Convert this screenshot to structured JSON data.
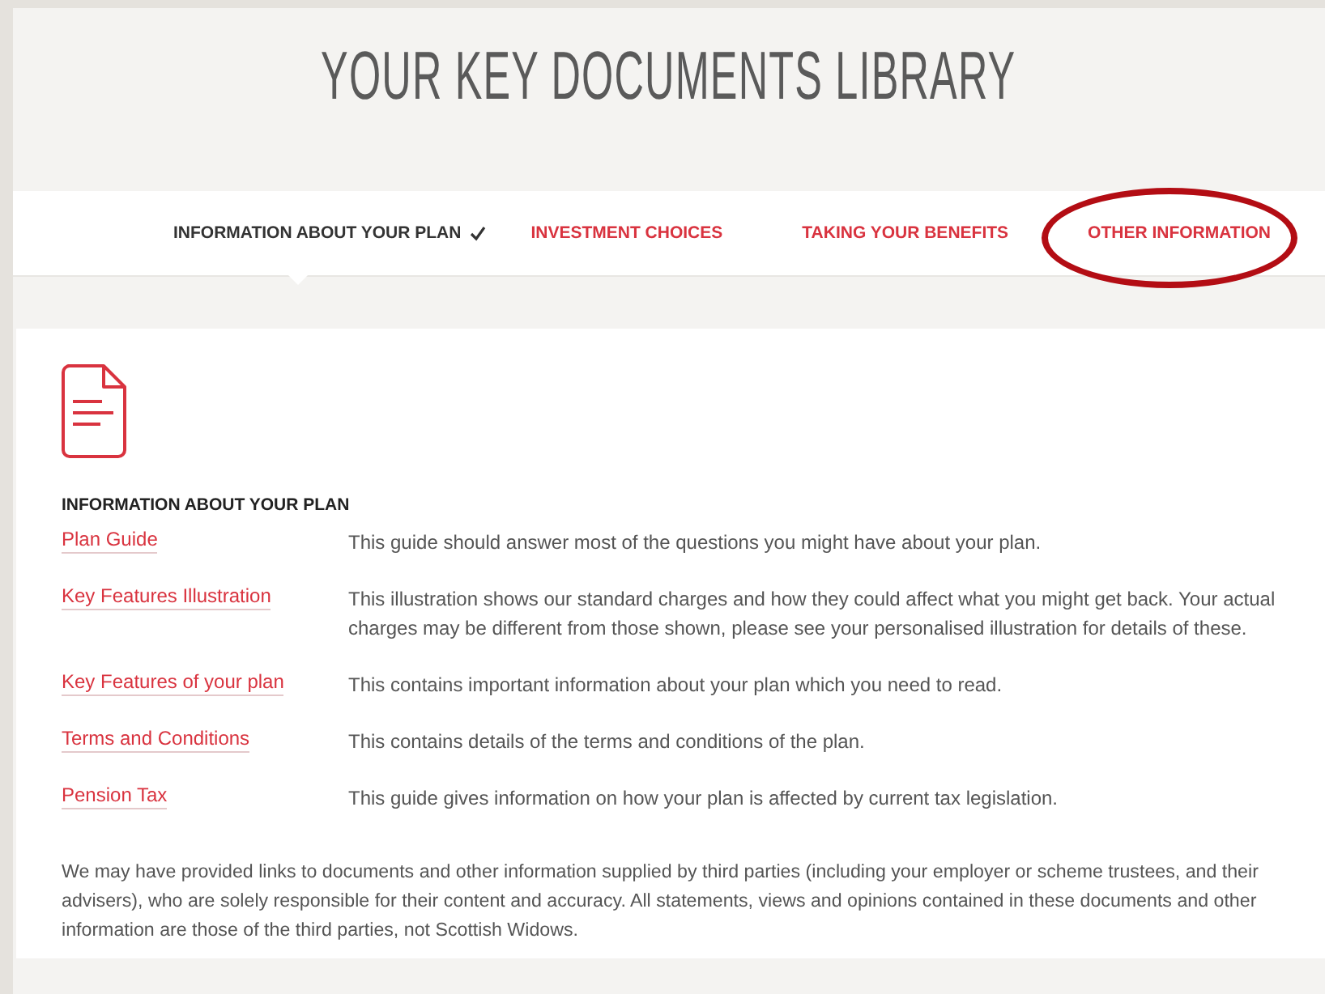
{
  "header": {
    "title": "YOUR KEY DOCUMENTS LIBRARY"
  },
  "tabs": [
    {
      "label": "INFORMATION ABOUT YOUR PLAN",
      "selected": true,
      "circled": false
    },
    {
      "label": "INVESTMENT CHOICES",
      "selected": false,
      "circled": false
    },
    {
      "label": "TAKING YOUR BENEFITS",
      "selected": false,
      "circled": false
    },
    {
      "label": "OTHER INFORMATION",
      "selected": false,
      "circled": true
    }
  ],
  "section": {
    "heading": "INFORMATION ABOUT YOUR PLAN",
    "documents": [
      {
        "link": "Plan Guide",
        "description": "This guide should answer most of the questions you might have about your plan."
      },
      {
        "link": "Key Features Illustration",
        "description": "This illustration shows our standard charges and how they could affect what you might get back. Your actual charges may be different from those shown, please see your personalised illustration for details of these."
      },
      {
        "link": "Key Features of your plan",
        "description": "This contains important information about your plan which you need to read."
      },
      {
        "link": "Terms and Conditions",
        "description": "This contains details of the terms and conditions of the plan."
      },
      {
        "link": "Pension Tax",
        "description": "This guide gives information on how your plan is affected by current tax legislation."
      }
    ]
  },
  "disclaimer": "We may have provided links to documents and other information supplied by third parties (including your employer or scheme trustees, and their advisers), who are solely responsible for their content and accuracy. All statements, views and opinions contained in these documents and other information are those of the third parties, not Scottish Widows."
}
